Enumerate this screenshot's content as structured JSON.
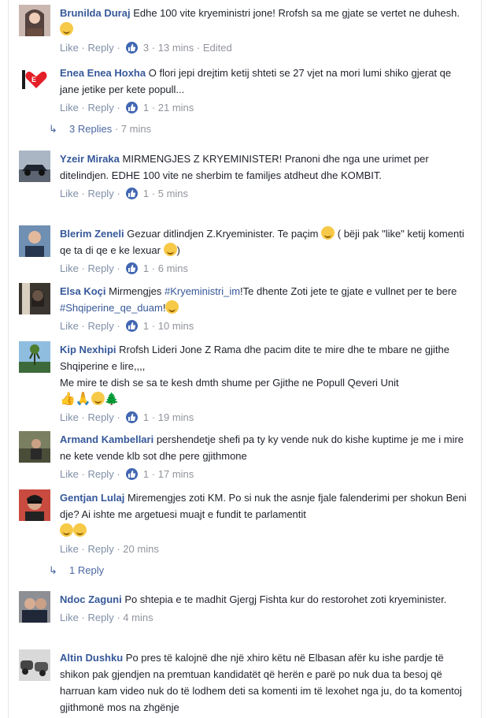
{
  "actions": {
    "like": "Like",
    "reply": "Reply",
    "dot": "·",
    "edited": "Edited"
  },
  "comments": [
    {
      "author": "Brunilda Duraj",
      "text": "Edhe 100 vite kryeministri jone! Rrofsh sa me gjate se vertet ne duhesh.",
      "likes": "3",
      "time": "13 mins"
    },
    {
      "author": "Enea Enea Hoxha",
      "text": "O flori jepi drejtim ketij shteti se 27 vjet na mori lumi shiko gjerat qe jane jetike per kete popull...",
      "likes": "1",
      "time": "21 mins"
    },
    {
      "author": "Yzeir Miraka",
      "text": "MIRMENGJES Z KRYEMINISTER! Pranoni dhe nga une urimet per ditelindjen. EDHE 100 vite ne sherbim te familjes atdheut dhe KOMBIT.",
      "likes": "1",
      "time": "5 mins"
    },
    {
      "author": "Blerim Zeneli",
      "text_a": "Gezuar ditlindjen Z.Kryeminister. Te paçim",
      "text_b": "( bëji pak \"like\" ketij komenti qe ta di qe e ke lexuar",
      "text_c": ")",
      "likes": "1",
      "time": "6 mins"
    },
    {
      "author": "Elsa Koçi",
      "text_a": "Mirmengjes",
      "tag1": "#Kryeministri_im",
      "text_b": "!Te dhente Zoti jete te gjate e vullnet per te bere",
      "tag2": "#Shqiperine_qe_duam",
      "text_c": "!",
      "likes": "1",
      "time": "10 mins"
    },
    {
      "author": "Kip Nexhipi",
      "text": "Rrofsh Lideri Jone Z Rama dhe pacim dite te mire dhe te mbare ne gjithe Shqiperine e lire,,,,",
      "text2": "Me mire te dish se sa te kesh dmth shume per Gjithe ne Popull Qeveri Unit",
      "likes": "1",
      "time": "19 mins"
    },
    {
      "author": "Armand Kambellari",
      "text": "pershendetje shefi pa ty ky vende nuk do kishe kuptime je me i mire ne kete vende klb sot dhe pere gjithmone",
      "likes": "1",
      "time": "17 mins"
    },
    {
      "author": "Gentjan Lulaj",
      "text": "Miremengjes zoti KM. Po si nuk the asnje fjale falenderimi per shokun Beni dje? Ai ishte me argetuesi muajt e fundit te parlamentit",
      "time": "20 mins"
    },
    {
      "author": "Ndoc Zaguni",
      "text": "Po shtepia e te madhit Gjergj Fishta kur do restorohet zoti kryeminister.",
      "time": "4 mins"
    },
    {
      "author": "Altin Dushku",
      "text": "Po pres të kalojnë dhe një xhiro këtu në Elbasan afër ku ishe pardje të shikon pak gjendjen na premtuan kandidatët që herën e parë po nuk dua ta besoj që harruan kam video nuk do të lodhem deti sa komenti im të lexohet nga ju, do ta komentoj gjithmonë mos na zhgënje"
    }
  ],
  "reply_links": [
    {
      "label": "3 Replies",
      "time": "7 mins"
    },
    {
      "label": "1 Reply"
    }
  ]
}
